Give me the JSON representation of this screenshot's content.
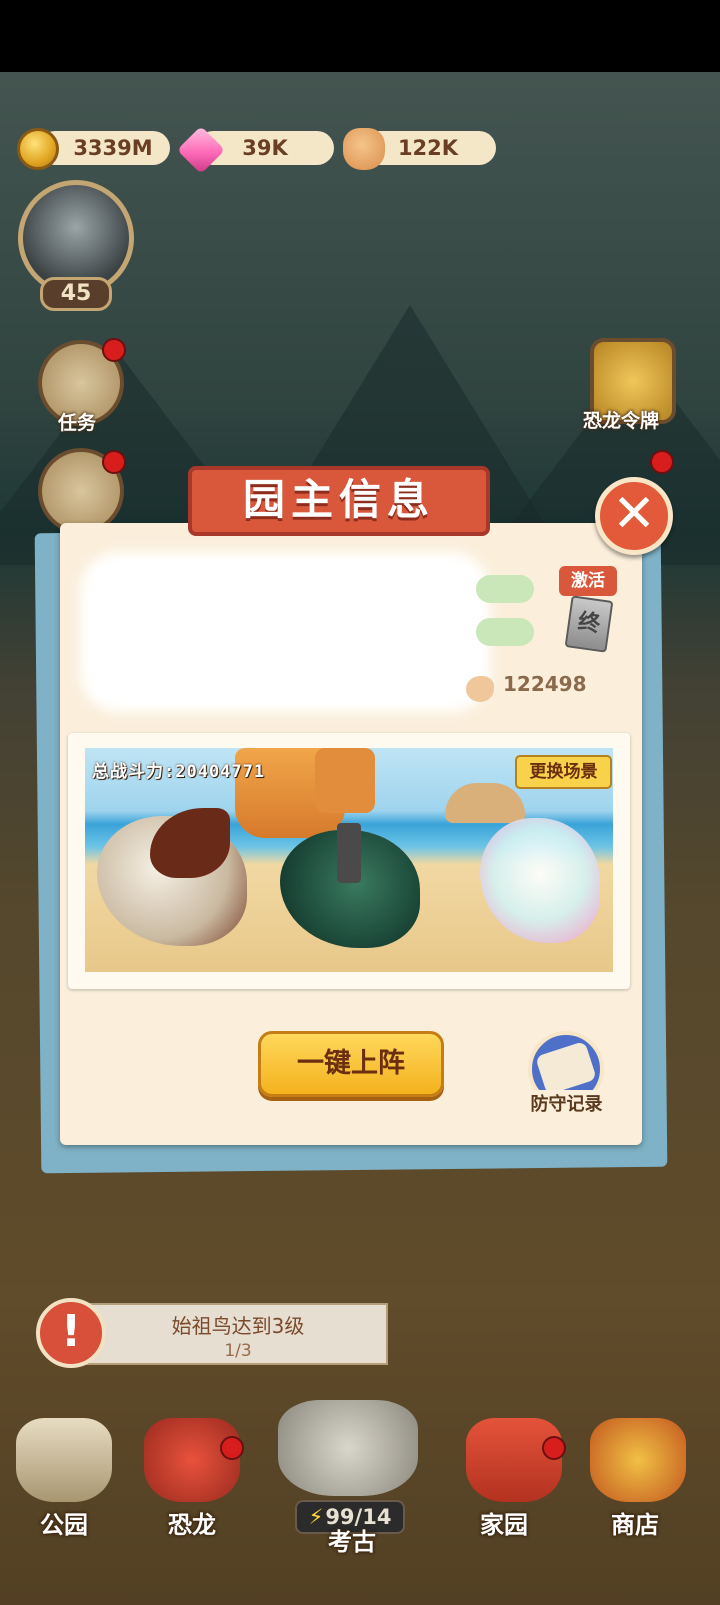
{
  "resources": {
    "coins": "3339M",
    "gems": "39K",
    "likes": "122K"
  },
  "player": {
    "level": "45"
  },
  "side_menu": {
    "task_label": "任务",
    "dino_token_label": "恐龙令牌"
  },
  "dialog": {
    "title": "园主信息",
    "close_symbol": "✕",
    "activate_label": "激活",
    "card_char": "终",
    "power_value": "122498",
    "total_power_label": "总战斗力:20404771",
    "change_scene_label": "更换场景",
    "deploy_button": "一键上阵",
    "defense_record_label": "防守记录"
  },
  "task": {
    "alert_symbol": "!",
    "title": "始祖鸟达到3级",
    "progress": "1/3"
  },
  "bottom_nav": {
    "park": "公园",
    "dinosaur": "恐龙",
    "archaeology": "考古",
    "stamina": "99/14",
    "home": "家园",
    "shop": "商店"
  },
  "colors": {
    "primary_red": "#d9573a",
    "panel_cream": "#fbefdc",
    "gold_button": "#f4b21e",
    "notification_red": "#d81d1d"
  }
}
